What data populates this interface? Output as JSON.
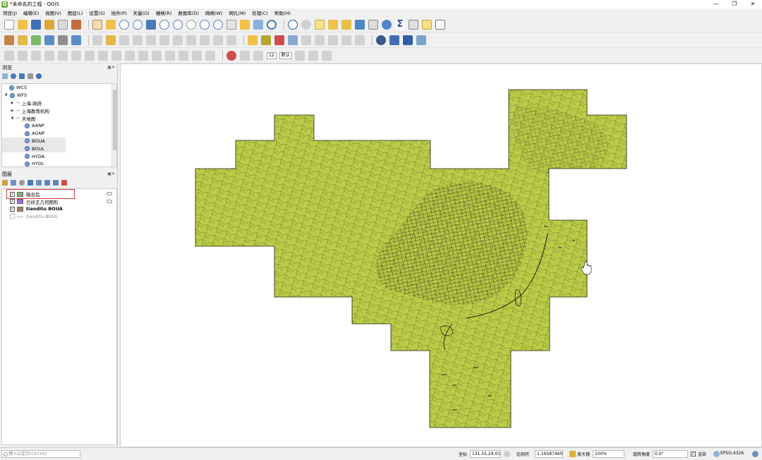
{
  "window": {
    "title": "*未命名的工程 - QGIS",
    "app_icon": "qgis-icon"
  },
  "menu": [
    "项目(J)",
    "编辑(E)",
    "视图(V)",
    "图层(L)",
    "设置(S)",
    "插件(P)",
    "矢量(O)",
    "栅格(R)",
    "数据库(D)",
    "网络(W)",
    "网孔(M)",
    "处理(C)",
    "帮助(H)"
  ],
  "toolbar3": {
    "font_size": "12",
    "font_name": "默认"
  },
  "browser": {
    "title": "浏览",
    "items": [
      {
        "label": "WCS",
        "type": "service"
      },
      {
        "label": "WFS",
        "type": "service"
      },
      {
        "label": "上海-政府",
        "type": "connection"
      },
      {
        "label": "上海教育机构",
        "type": "connection"
      },
      {
        "label": "天地图",
        "type": "connection"
      },
      {
        "label": "AANP",
        "type": "layer"
      },
      {
        "label": "AGNP",
        "type": "layer"
      },
      {
        "label": "BOUA",
        "type": "layer"
      },
      {
        "label": "BOUL",
        "type": "layer"
      },
      {
        "label": "HYDA",
        "type": "layer"
      },
      {
        "label": "HYDL",
        "type": "layer"
      }
    ]
  },
  "layers": {
    "title": "图层",
    "items": [
      {
        "label": "融合后",
        "checked": true,
        "color": "#7db76a",
        "style": "normal"
      },
      {
        "label": "已修正几何图形",
        "checked": true,
        "color": "#9b6bd1",
        "style": "normal"
      },
      {
        "label": "tianditu BOUA",
        "checked": true,
        "color": "#b07a67",
        "style": "bold"
      },
      {
        "label": "tianditu BOUL",
        "checked": false,
        "color": "#aaaaaa",
        "style": "italic"
      }
    ]
  },
  "map": {
    "fill_color": "#bccb47",
    "stroke_color": "#1f2a10"
  },
  "status": {
    "locator_placeholder": "键入以定位(Ctrl+K)",
    "coord_label": "坐标",
    "coord_value": "131.55,29.01",
    "scale_label": "比例尺",
    "scale_value": "1:16587460",
    "magnifier_label": "放大镜",
    "magnifier_value": "100%",
    "rotation_label": "旋转角度",
    "rotation_value": "0.0°",
    "render_label": "渲染",
    "crs_value": "EPSG:4326"
  }
}
